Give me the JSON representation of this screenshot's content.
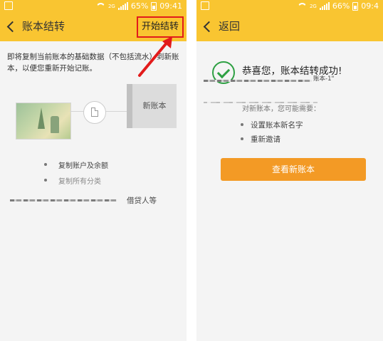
{
  "left_screen": {
    "status": {
      "battery": "65%",
      "time": "09:41",
      "network": "2G"
    },
    "header": {
      "title": "账本结转",
      "start_label": "开始结转"
    },
    "description": "即将复制当前账本的基础数据（不包括流水）到新账本，以便您重新开始记账。",
    "new_book_label": "新账本",
    "bullets": [
      "复制账户及余额",
      "复制所有分类"
    ],
    "footer_tail": "借贷人等"
  },
  "right_screen": {
    "status": {
      "battery": "66%",
      "time": "09:4",
      "network": "2G"
    },
    "header": {
      "back_label": "返回"
    },
    "success_message": "恭喜您，账本结转成功!",
    "new_book_name": "账本-1\"",
    "hint": "对新账本，您可能需要：",
    "bullets": [
      "设置账本新名字",
      "重新邀请"
    ],
    "view_button": "查看新账本"
  },
  "colors": {
    "titlebar": "#f9c531",
    "highlight_box": "#e21b1b",
    "primary_button": "#f39a25",
    "success": "#2ea043"
  }
}
